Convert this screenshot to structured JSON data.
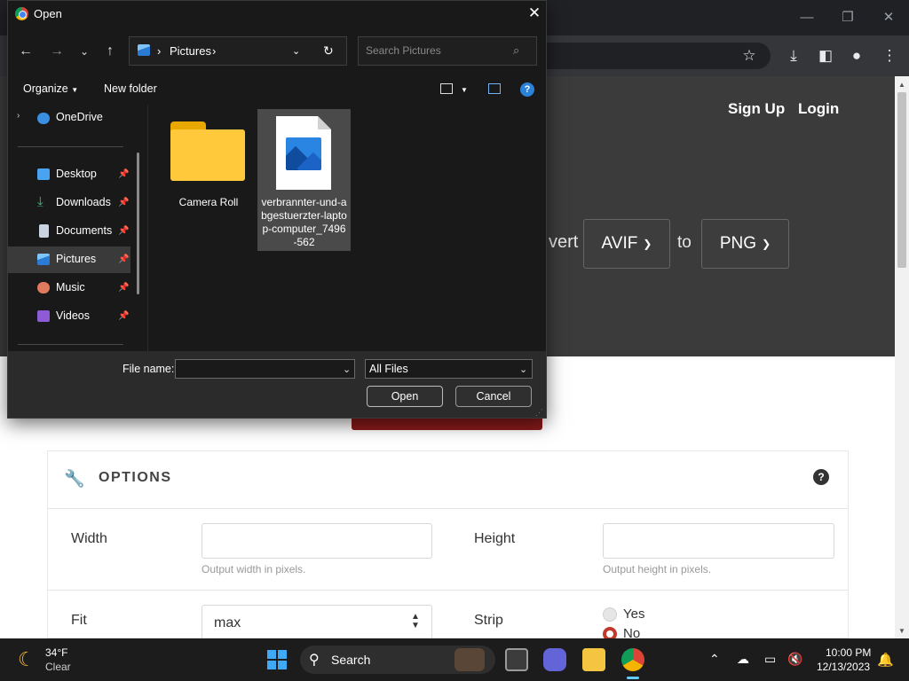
{
  "browser": {
    "window_controls": [
      "—",
      "❐",
      "✕"
    ],
    "toolbar_icons": [
      "star-icon",
      "download-icon",
      "sidepanel-icon",
      "profile-icon",
      "kebab-menu-icon"
    ]
  },
  "site": {
    "nav": {
      "signup": "Sign Up",
      "login": "Login"
    },
    "convert_word": "vert",
    "from_format": "AVIF",
    "to_word": "to",
    "to_format": "PNG",
    "options": {
      "title": "OPTIONS",
      "help": "?",
      "width_label": "Width",
      "width_hint": "Output width in pixels.",
      "height_label": "Height",
      "height_hint": "Output height in pixels.",
      "fit_label": "Fit",
      "fit_value": "max",
      "strip_label": "Strip",
      "strip_yes": "Yes",
      "strip_no": "No",
      "strip_selected": "No"
    }
  },
  "dialog": {
    "title": "Open",
    "address": {
      "location": "Pictures"
    },
    "search_placeholder": "Search Pictures",
    "commands": {
      "organize": "Organize",
      "new_folder": "New folder"
    },
    "nav_items": [
      {
        "label": "OneDrive",
        "icon": "cloud-icon",
        "pinned": false,
        "selected": false
      },
      {
        "label": "Desktop",
        "icon": "desktop-icon",
        "pinned": true,
        "selected": false
      },
      {
        "label": "Downloads",
        "icon": "download-arrow-icon",
        "pinned": true,
        "selected": false
      },
      {
        "label": "Documents",
        "icon": "documents-icon",
        "pinned": true,
        "selected": false
      },
      {
        "label": "Pictures",
        "icon": "pictures-icon",
        "pinned": true,
        "selected": true
      },
      {
        "label": "Music",
        "icon": "music-icon",
        "pinned": true,
        "selected": false
      },
      {
        "label": "Videos",
        "icon": "videos-icon",
        "pinned": true,
        "selected": false
      }
    ],
    "files": [
      {
        "name": "Camera Roll",
        "type": "folder",
        "selected": false
      },
      {
        "name": "verbrannter-und-abgestuerzter-laptop-computer_7496-562",
        "type": "image",
        "selected": true
      }
    ],
    "file_name_label": "File name:",
    "file_name_value": "",
    "file_type": "All Files",
    "open_button": "Open",
    "cancel_button": "Cancel"
  },
  "taskbar": {
    "weather": {
      "temp": "34°F",
      "condition": "Clear"
    },
    "search_label": "Search",
    "clock": {
      "time": "10:00 PM",
      "date": "12/13/2023"
    }
  },
  "colors": {
    "hero_bg": "#3b3b3b",
    "dialog_bg": "#191919",
    "accent_blue": "#2b82d9",
    "radio_selected": "#c0392b"
  }
}
